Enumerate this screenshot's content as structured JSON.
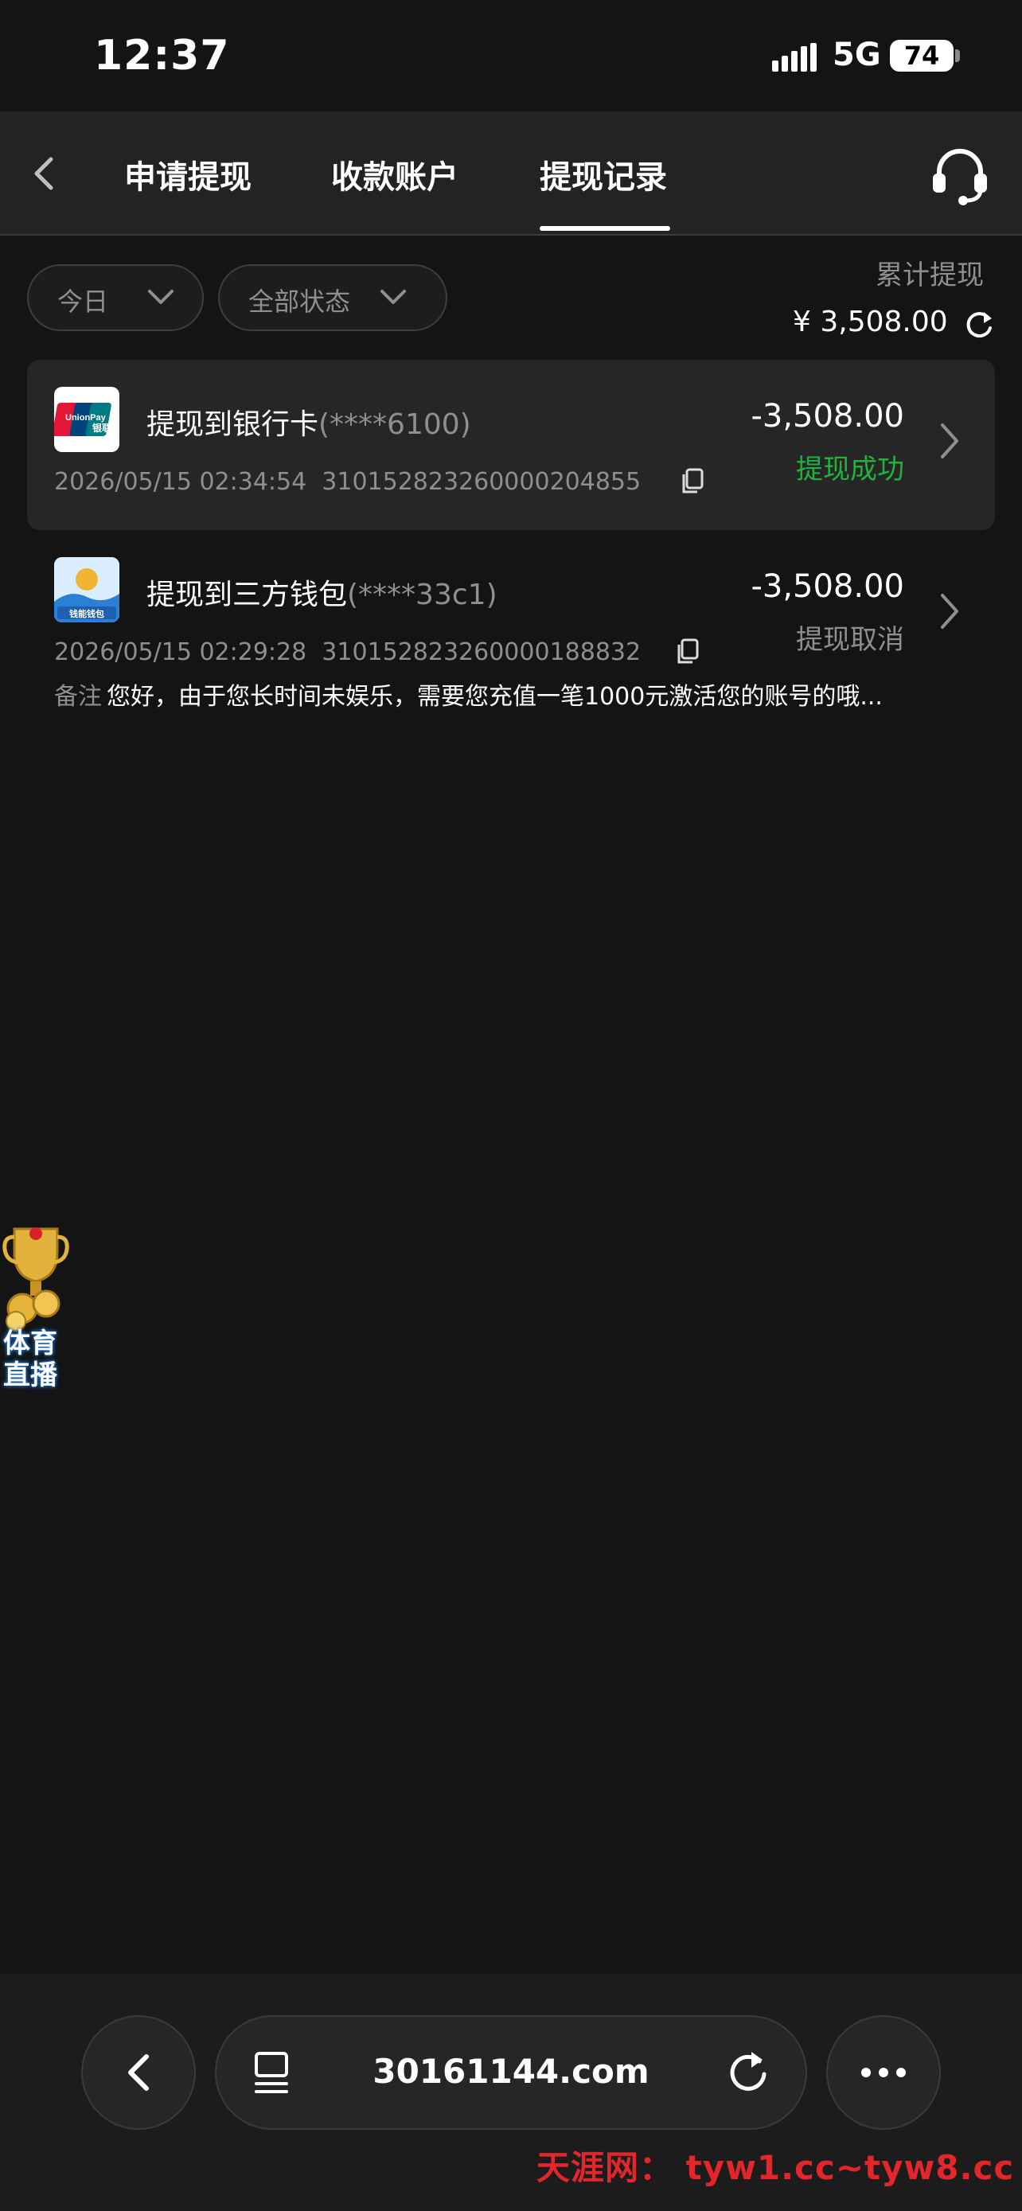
{
  "status_bar": {
    "time": "12:37",
    "network": "5G",
    "battery": "74"
  },
  "header": {
    "tabs": [
      {
        "label": "申请提现"
      },
      {
        "label": "收款账户"
      },
      {
        "label": "提现记录"
      }
    ],
    "active_tab": "提现记录"
  },
  "filters": {
    "date": "今日",
    "status": "全部状态"
  },
  "summary": {
    "label": "累计提现",
    "amount": "¥ 3,508.00"
  },
  "records": [
    {
      "title": "提现到银行卡",
      "account_mask": "(****6100)",
      "datetime": "2026/05/15 02:34:54",
      "order_no": "310152823260000204855",
      "amount": "-3,508.00",
      "status": "提现成功",
      "status_color": "#22b23c"
    },
    {
      "title": "提现到三方钱包",
      "account_mask": "(****33c1)",
      "datetime": "2026/05/15 02:29:28",
      "order_no": "310152823260000188832",
      "amount": "-3,508.00",
      "status": "提现取消",
      "status_color": "#8f8f8f",
      "remark_label": "备注",
      "remark": "您好，由于您长时间未娱乐，需要您充值一笔1000元激活您的账号的哦..."
    }
  ],
  "logos": {
    "unionpay_text": "UnionPay",
    "unionpay_cn": "银联",
    "wallet_text": "钱能钱包"
  },
  "floating_widget": {
    "line1": "体育",
    "line2": "直播"
  },
  "browser": {
    "url": "30161144.com"
  },
  "watermark": "天涯网： tyw1.cc~tyw8.cc"
}
